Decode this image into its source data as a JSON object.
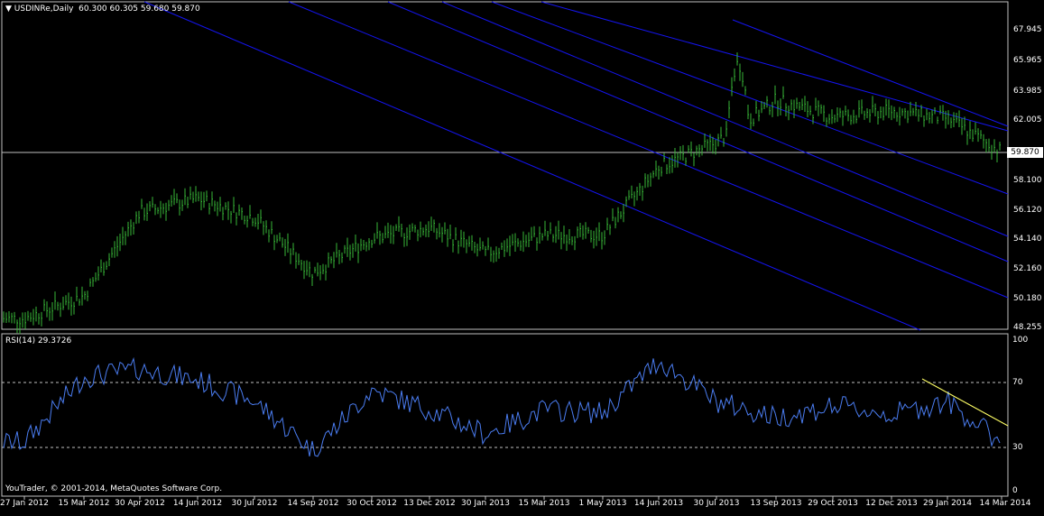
{
  "chart_header": {
    "symbol": "USDINRe,Daily",
    "ohlc": "60.300 60.305 59.680 59.870"
  },
  "price_axis": {
    "labels": [
      "67.945",
      "65.965",
      "63.985",
      "62.005",
      "58.100",
      "56.120",
      "54.140",
      "52.160",
      "50.180",
      "48.255"
    ],
    "current_price": "59.870"
  },
  "rsi_panel": {
    "title": "RSI(14) 29.3726",
    "levels": [
      "100",
      "70",
      "30",
      "0"
    ]
  },
  "time_axis": {
    "labels": [
      "27 Jan 2012",
      "15 Mar 2012",
      "30 Apr 2012",
      "14 Jun 2012",
      "30 Jul 2012",
      "14 Sep 2012",
      "30 Oct 2012",
      "13 Dec 2012",
      "30 Jan 2013",
      "15 Mar 2013",
      "1 May 2013",
      "14 Jun 2013",
      "30 Jul 2013",
      "13 Sep 2013",
      "29 Oct 2013",
      "12 Dec 2013",
      "29 Jan 2014",
      "14 Mar 2014"
    ]
  },
  "footer": {
    "copyright": "YouTrader, © 2001-2014, MetaQuotes Software Corp."
  },
  "colors": {
    "background": "#000000",
    "bars": "#38b838",
    "channel_lines": "#1414f0",
    "rsi_line": "#4a7cf0",
    "trendline": "#ffff66",
    "grid": "#c0c0c0"
  },
  "chart_data": [
    {
      "type": "line",
      "title": "USDINRe,Daily",
      "x": [
        "27 Jan 2012",
        "15 Mar 2012",
        "30 Apr 2012",
        "14 Jun 2012",
        "30 Jul 2012",
        "14 Sep 2012",
        "30 Oct 2012",
        "13 Dec 2012",
        "30 Jan 2013",
        "15 Mar 2013",
        "1 May 2013",
        "14 Jun 2013",
        "30 Jul 2013",
        "13 Sep 2013",
        "29 Oct 2013",
        "12 Dec 2013",
        "29 Jan 2014",
        "14 Mar 2014"
      ],
      "series": [
        {
          "values": [
            48.9,
            50.4,
            55.9,
            56.8,
            55.6,
            51.9,
            54.2,
            54.9,
            53.2,
            54.4,
            54.4,
            58.9,
            60.5,
            63.3,
            62.2,
            62.6,
            62.1,
            59.9
          ]
        }
      ],
      "ylim": [
        48.255,
        69.9
      ],
      "current": 59.87
    },
    {
      "type": "line",
      "title": "RSI(14) 29.3726",
      "x": [
        "27 Jan 2012",
        "15 Mar 2012",
        "30 Apr 2012",
        "14 Jun 2012",
        "30 Jul 2012",
        "14 Sep 2012",
        "30 Oct 2012",
        "13 Dec 2012",
        "30 Jan 2013",
        "15 Mar 2013",
        "1 May 2013",
        "14 Jun 2013",
        "30 Jul 2013",
        "13 Sep 2013",
        "29 Oct 2013",
        "12 Dec 2013",
        "29 Jan 2014",
        "14 Mar 2014"
      ],
      "series": [
        {
          "values": [
            30,
            70,
            75,
            68,
            55,
            25,
            62,
            50,
            35,
            50,
            48,
            80,
            55,
            45,
            52,
            47,
            55,
            29.37
          ]
        }
      ],
      "ylim": [
        0,
        100
      ],
      "levels": [
        30,
        70
      ]
    }
  ]
}
